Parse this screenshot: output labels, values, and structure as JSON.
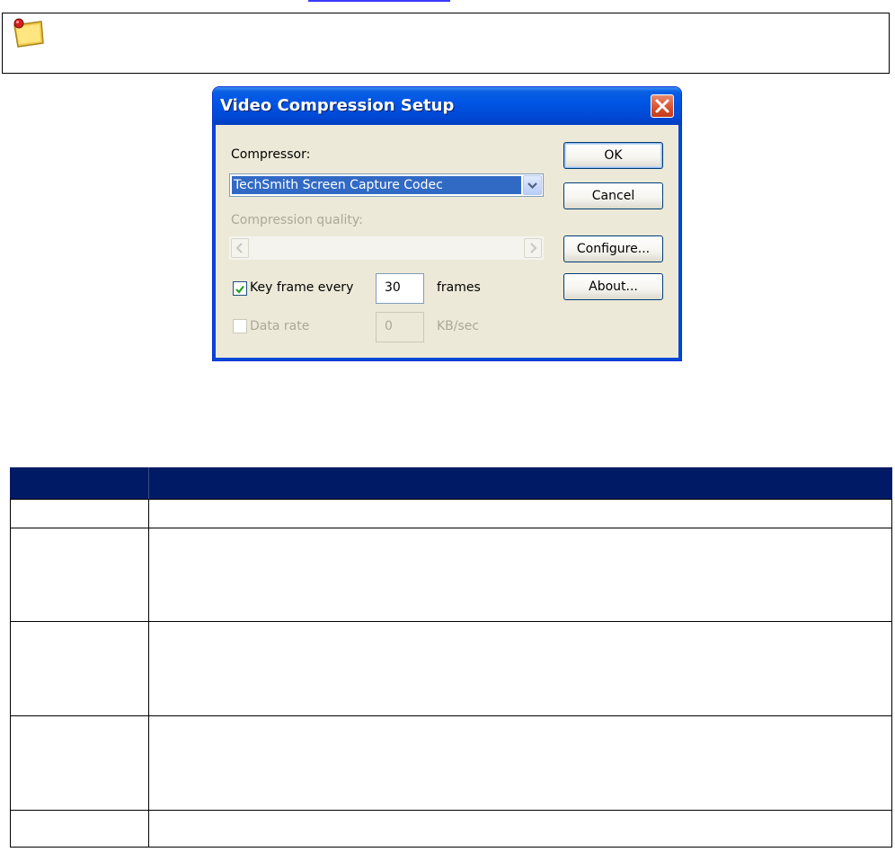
{
  "dialog": {
    "title": "Video Compression Setup",
    "compressor_label": "Compressor:",
    "compressor_value": "TechSmith Screen Capture Codec",
    "quality_label": "Compression quality:",
    "keyframe_checked": true,
    "keyframe_label": "Key frame every",
    "keyframe_value": "30",
    "keyframe_unit": "frames",
    "datarate_checked": false,
    "datarate_label": "Data rate",
    "datarate_value": "0",
    "datarate_unit": "KB/sec",
    "buttons": {
      "ok": "OK",
      "cancel": "Cancel",
      "configure": "Configure...",
      "about": "About..."
    }
  },
  "icons": {
    "note": "sticky-note-icon",
    "close": "close-icon",
    "dropdown": "chevron-down-icon",
    "scroll_left": "chevron-left-icon",
    "scroll_right": "chevron-right-icon",
    "check": "checkmark-icon"
  },
  "colors": {
    "titlebar": "#0055e5",
    "dialog_bg": "#ece9d8",
    "selection": "#316ac5",
    "table_header": "#001a66",
    "close_button": "#d8502c"
  }
}
